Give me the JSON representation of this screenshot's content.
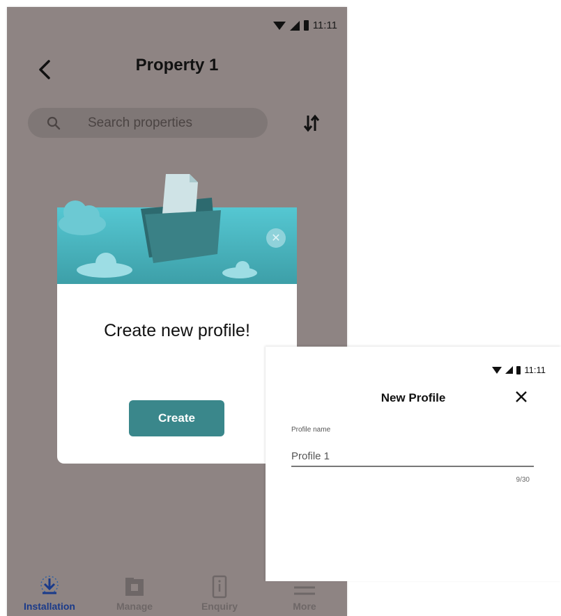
{
  "screen1": {
    "status": {
      "time": "11:11"
    },
    "header": {
      "title": "Property 1"
    },
    "search": {
      "placeholder": "Search properties"
    },
    "modal": {
      "title": "Create new profile!",
      "create_label": "Create"
    },
    "bottom_nav": [
      {
        "label": "Installation",
        "icon": "download-icon",
        "active": true
      },
      {
        "label": "Manage",
        "icon": "folder-icon",
        "active": false
      },
      {
        "label": "Enquiry",
        "icon": "info-phone-icon",
        "active": false
      },
      {
        "label": "More",
        "icon": "menu-icon",
        "active": false
      }
    ]
  },
  "screen2": {
    "status": {
      "time": "11:11"
    },
    "header": {
      "title": "New Profile"
    },
    "field": {
      "label": "Profile name",
      "value": "Profile 1",
      "counter": "9/30"
    }
  },
  "colors": {
    "backdrop": "#8e8483",
    "accent": "#3a878b",
    "banner": "#55c7d2",
    "active_nav": "#1a3a8a"
  }
}
